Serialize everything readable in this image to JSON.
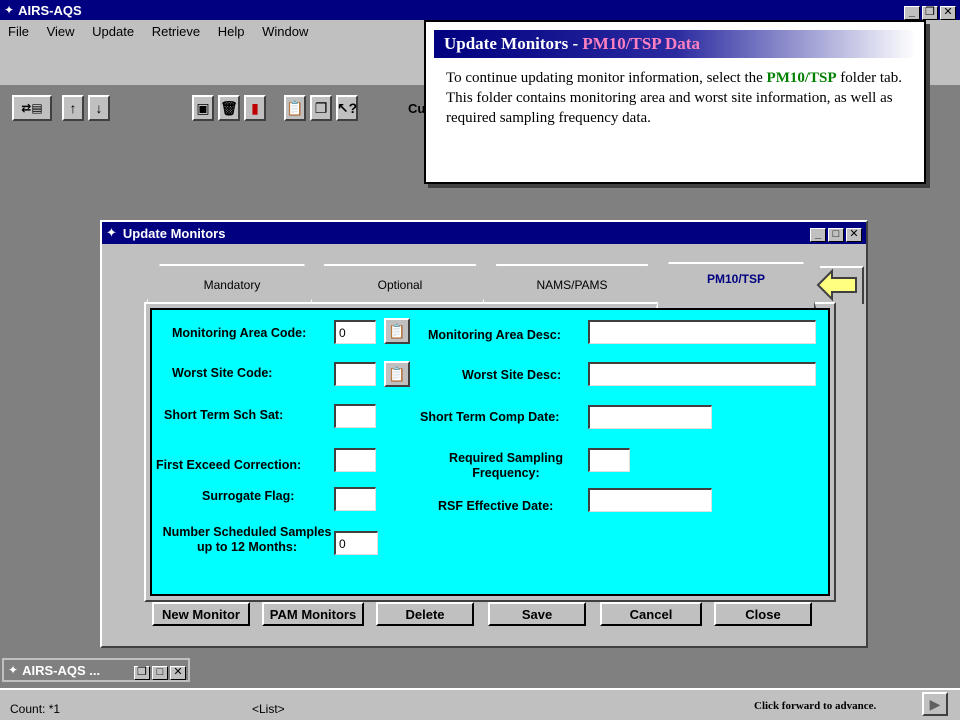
{
  "app": {
    "title": "AIRS-AQS"
  },
  "menu": [
    "File",
    "View",
    "Update",
    "Retrieve",
    "Help",
    "Window"
  ],
  "toolbar": {
    "cut_text": "Cu"
  },
  "callout": {
    "title": "Update Monitors - ",
    "title_highlight": "PM10/TSP Data",
    "text_before": "To continue updating monitor information, select the",
    "text_highlight": "PM10/TSP",
    "text_after": " folder tab.  This folder contains monitoring area and worst site information, as well as required sampling frequency data."
  },
  "dialog": {
    "title": "Update Monitors"
  },
  "tabs": [
    "Mandatory",
    "Optional",
    "NAMS/PAMS",
    "PM10/TSP"
  ],
  "form": {
    "monitoring_area_code_label": "Monitoring Area Code:",
    "monitoring_area_code_value": "0",
    "monitoring_area_desc_label": "Monitoring Area Desc:",
    "worst_site_code_label": "Worst Site Code:",
    "worst_site_desc_label": "Worst Site Desc:",
    "short_term_sch_sat_label": "Short Term Sch Sat:",
    "short_term_comp_date_label": "Short Term Comp Date:",
    "first_exceed_correction_label": "First Exceed Correction:",
    "required_sampling_freq_label": "Required Sampling Frequency:",
    "surrogate_flag_label": "Surrogate Flag:",
    "rsf_effective_date_label": "RSF Effective Date:",
    "number_scheduled_label": "Number Scheduled Samples up to 12 Months:",
    "number_scheduled_value": "0"
  },
  "buttons": [
    "New Monitor",
    "PAM Monitors",
    "Delete",
    "Save",
    "Cancel",
    "Close"
  ],
  "minimized": {
    "title": "AIRS-AQS ..."
  },
  "status": {
    "count": "Count: *1",
    "list": "<List>",
    "advance": "Click forward to advance."
  }
}
